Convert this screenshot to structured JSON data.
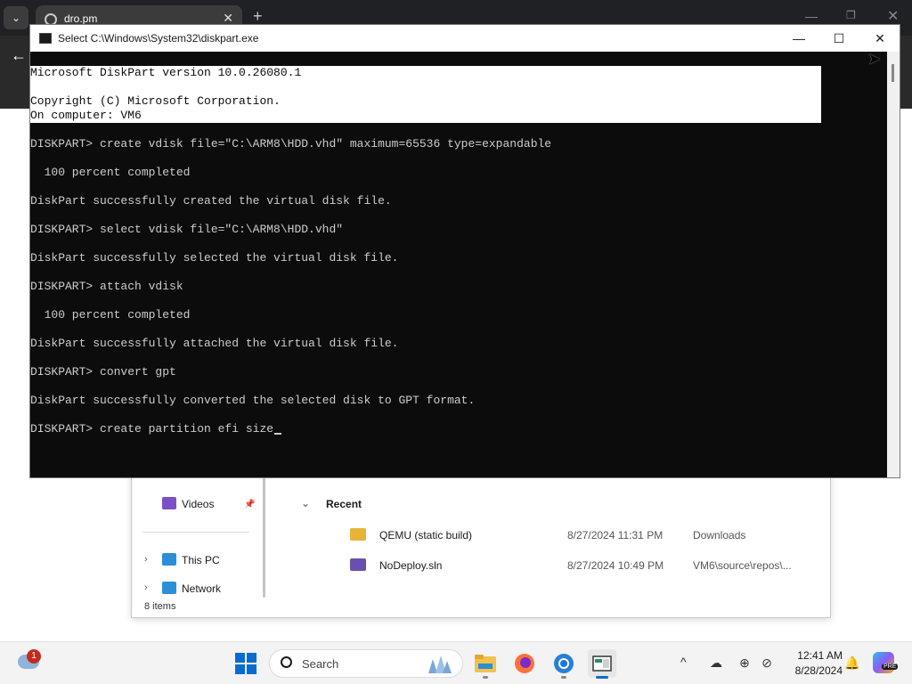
{
  "browser": {
    "tab_title": "dro.pm",
    "new_tab_glyph": "+",
    "close_glyph": "✕",
    "minimize_glyph": "—",
    "restore_glyph": "❐",
    "back_glyph": "←",
    "menu_glyph": "⌄"
  },
  "console": {
    "title": "Select C:\\Windows\\System32\\diskpart.exe",
    "lines": [
      {
        "text": "Microsoft DiskPart version 10.0.26080.1",
        "selected": true
      },
      {
        "text": "",
        "selected": true
      },
      {
        "text": "Copyright (C) Microsoft Corporation.",
        "selected": true
      },
      {
        "text": "On computer: VM6",
        "selected": true
      },
      {
        "text": "",
        "selected": false
      },
      {
        "text": "DISKPART> create vdisk file=\"C:\\ARM8\\HDD.vhd\" maximum=65536 type=expandable",
        "selected": false
      },
      {
        "text": "",
        "selected": false
      },
      {
        "text": "  100 percent completed",
        "selected": false
      },
      {
        "text": "",
        "selected": false
      },
      {
        "text": "DiskPart successfully created the virtual disk file.",
        "selected": false
      },
      {
        "text": "",
        "selected": false
      },
      {
        "text": "DISKPART> select vdisk file=\"C:\\ARM8\\HDD.vhd\"",
        "selected": false
      },
      {
        "text": "",
        "selected": false
      },
      {
        "text": "DiskPart successfully selected the virtual disk file.",
        "selected": false
      },
      {
        "text": "",
        "selected": false
      },
      {
        "text": "DISKPART> attach vdisk",
        "selected": false
      },
      {
        "text": "",
        "selected": false
      },
      {
        "text": "  100 percent completed",
        "selected": false
      },
      {
        "text": "",
        "selected": false
      },
      {
        "text": "DiskPart successfully attached the virtual disk file.",
        "selected": false
      },
      {
        "text": "",
        "selected": false
      },
      {
        "text": "DISKPART> convert gpt",
        "selected": false
      },
      {
        "text": "",
        "selected": false
      },
      {
        "text": "DiskPart successfully converted the selected disk to GPT format.",
        "selected": false
      },
      {
        "text": "",
        "selected": false
      }
    ],
    "prompt_line": "DISKPART> create partition efi size",
    "controls": {
      "minimize": "—",
      "maximize": "☐",
      "close": "✕"
    }
  },
  "explorer": {
    "nav": {
      "videos": "Videos",
      "this_pc": "This PC",
      "network": "Network"
    },
    "status": "8 items",
    "section_title": "Recent",
    "files": [
      {
        "name": "QEMU (static build)",
        "date": "8/27/2024 11:31 PM",
        "location": "Downloads",
        "icon_color": "#e8b339"
      },
      {
        "name": "NoDeploy.sln",
        "date": "8/27/2024 10:49 PM",
        "location": "VM6\\source\\repos\\...",
        "icon_color": "#6a4fb3"
      }
    ]
  },
  "taskbar": {
    "notification_count": "1",
    "search_label": "Search",
    "clock_time": "12:41 AM",
    "clock_date": "8/28/2024",
    "copilot_badge": "PRE",
    "accent": "#0a6cd1"
  }
}
